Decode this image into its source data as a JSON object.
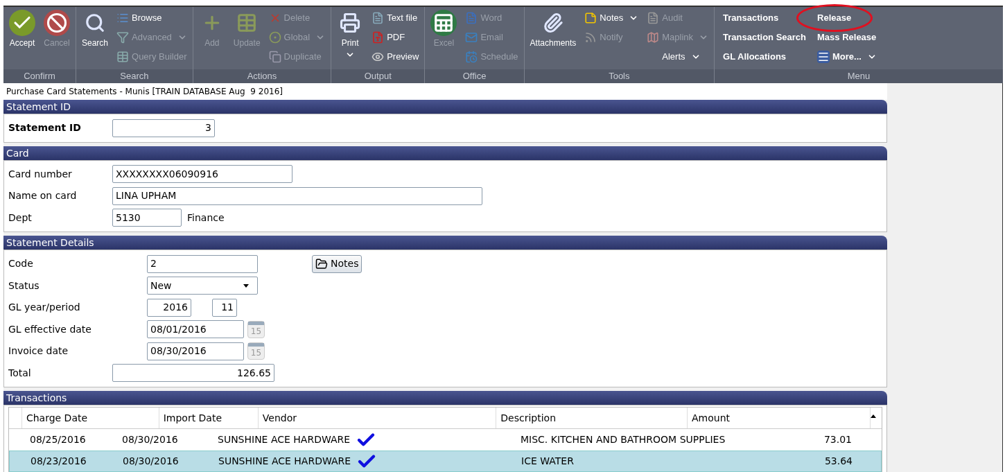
{
  "toolbar": {
    "groups": [
      {
        "label": "Confirm",
        "large": [
          {
            "label": "Accept",
            "disabled": false,
            "dropdown": false
          },
          {
            "label": "Cancel",
            "disabled": true,
            "dropdown": false
          }
        ]
      },
      {
        "label": "Search",
        "large": [
          {
            "label": "Search",
            "disabled": false,
            "dropdown": false
          }
        ],
        "small": [
          [
            {
              "label": "Browse",
              "disabled": false,
              "dropdown": false
            },
            {
              "label": "Advanced",
              "disabled": true,
              "dropdown": true
            },
            {
              "label": "Query Builder",
              "disabled": true,
              "dropdown": false
            }
          ]
        ]
      },
      {
        "label": "Actions",
        "large": [
          {
            "label": "Add",
            "disabled": true,
            "dropdown": false
          },
          {
            "label": "Update",
            "disabled": true,
            "dropdown": false
          }
        ],
        "small": [
          [
            {
              "label": "Delete",
              "disabled": true,
              "dropdown": false
            },
            {
              "label": "Global",
              "disabled": true,
              "dropdown": true
            },
            {
              "label": "Duplicate",
              "disabled": true,
              "dropdown": false
            }
          ]
        ]
      },
      {
        "label": "Output",
        "large": [
          {
            "label": "Print",
            "disabled": false,
            "dropdown": true
          }
        ],
        "small": [
          [
            {
              "label": "Text file",
              "disabled": false,
              "dropdown": false
            },
            {
              "label": "PDF",
              "disabled": false,
              "dropdown": false
            },
            {
              "label": "Preview",
              "disabled": false,
              "dropdown": false
            }
          ]
        ]
      },
      {
        "label": "Office",
        "large": [
          {
            "label": "Excel",
            "disabled": true,
            "dropdown": false
          }
        ],
        "small": [
          [
            {
              "label": "Word",
              "disabled": true,
              "dropdown": false
            },
            {
              "label": "Email",
              "disabled": true,
              "dropdown": false
            },
            {
              "label": "Schedule",
              "disabled": true,
              "dropdown": false
            }
          ]
        ]
      },
      {
        "label": "Tools",
        "large": [
          {
            "label": "Attachments",
            "disabled": false,
            "dropdown": false
          }
        ],
        "small": [
          [
            {
              "label": "Notes",
              "disabled": false,
              "dropdown": true
            },
            {
              "label": "Notify",
              "disabled": true,
              "dropdown": false
            }
          ],
          [
            {
              "label": "Audit",
              "disabled": true,
              "dropdown": false
            },
            {
              "label": "Maplink",
              "disabled": true,
              "dropdown": true
            },
            {
              "label": "Alerts",
              "disabled": false,
              "dropdown": true
            }
          ]
        ]
      }
    ],
    "menu": {
      "label": "Menu",
      "columns": [
        [
          {
            "label": "Transactions",
            "circled": false,
            "dropdown": false
          },
          {
            "label": "Transaction Search",
            "circled": false,
            "dropdown": false
          },
          {
            "label": "GL Allocations",
            "circled": false,
            "dropdown": false
          }
        ],
        [
          {
            "label": "Release",
            "circled": true,
            "dropdown": false
          },
          {
            "label": "Mass Release",
            "circled": false,
            "dropdown": false
          },
          {
            "label": "More...",
            "circled": false,
            "dropdown": true
          }
        ]
      ]
    }
  },
  "window_title": "Purchase Card Statements - Munis [TRAIN DATABASE Aug  9 2016]",
  "sections": [
    {
      "title": "Statement ID",
      "fields": [
        {
          "kind": "number",
          "label": "Statement ID",
          "bold": true,
          "value": "3"
        }
      ]
    },
    {
      "title": "Card",
      "fields": [
        {
          "kind": "text",
          "label": "Card number",
          "bold": false,
          "value": "XXXXXXXX06090916"
        },
        {
          "kind": "text",
          "label": "Name on card",
          "bold": false,
          "value": "LINA UPHAM"
        },
        {
          "kind": "described",
          "label": "Dept",
          "bold": false,
          "value": "5130",
          "description": "Finance"
        }
      ]
    },
    {
      "title": "Statement Details",
      "fields": [
        {
          "kind": "text_button",
          "label": "Code",
          "bold": false,
          "value": "2",
          "button": "Notes"
        },
        {
          "kind": "select",
          "label": "Status",
          "bold": false,
          "value": "New"
        },
        {
          "kind": "pair",
          "label": "GL year/period",
          "bold": false,
          "value": "2016",
          "value2": "11"
        },
        {
          "kind": "date",
          "label": "GL effective date",
          "bold": false,
          "value": "08/01/2016",
          "calendar": "15"
        },
        {
          "kind": "date",
          "label": "Invoice date",
          "bold": false,
          "value": "08/30/2016",
          "calendar": "15"
        },
        {
          "kind": "number",
          "label": "Total",
          "bold": false,
          "value": "126.65"
        }
      ]
    }
  ],
  "transactions": {
    "title": "Transactions",
    "columns": [
      "Charge Date",
      "Import Date",
      "Vendor",
      "Description",
      "Amount"
    ],
    "rows": [
      {
        "cells": [
          "08/25/2016",
          "08/30/2016",
          "SUNSHINE ACE HARDWARE",
          "MISC. KITCHEN AND BATHROOM SUPPLIES",
          "73.01"
        ],
        "selected": false,
        "ticked": true
      },
      {
        "cells": [
          "08/23/2016",
          "08/30/2016",
          "SUNSHINE ACE HARDWARE",
          "ICE WATER",
          "53.64"
        ],
        "selected": true,
        "ticked": true
      }
    ]
  }
}
